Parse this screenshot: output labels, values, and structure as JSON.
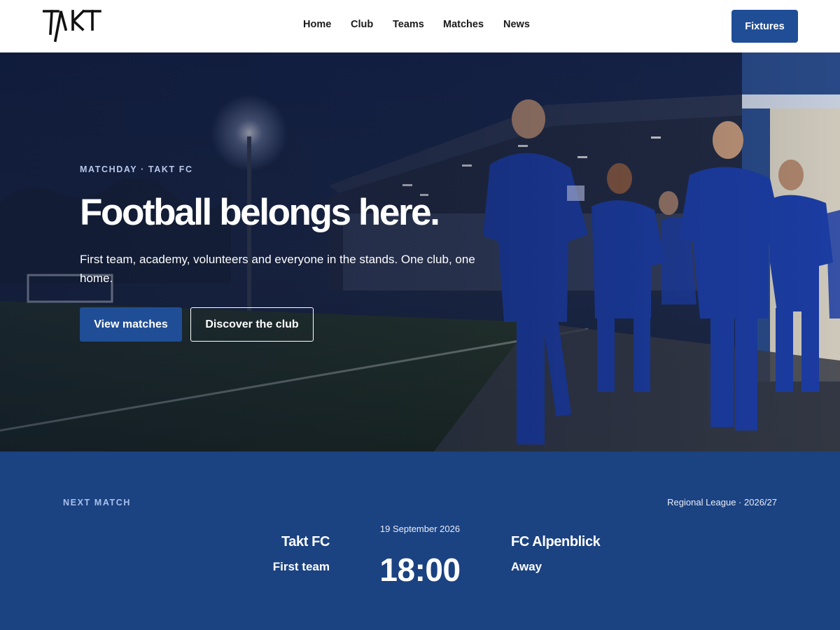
{
  "brand": {
    "logo_text": "TAKT",
    "primary_color": "#1f4e96",
    "band_color": "#1b4281"
  },
  "nav": {
    "items": [
      {
        "label": "Home"
      },
      {
        "label": "Club"
      },
      {
        "label": "Teams"
      },
      {
        "label": "Matches"
      },
      {
        "label": "News"
      }
    ],
    "cta_label": "Fixtures"
  },
  "hero": {
    "eyebrow": "MATCHDAY · TAKT FC",
    "title": "Football belongs here.",
    "subtitle": "First team, academy, volunteers and everyone in the stands. One club, one home.",
    "primary_button": "View matches",
    "secondary_button": "Discover the club"
  },
  "next_match": {
    "label": "NEXT MATCH",
    "competition": "Regional League · 2026/27",
    "date": "19 September 2026",
    "time": "18:00",
    "home": {
      "name": "Takt FC",
      "detail": "First team"
    },
    "away": {
      "name": "FC Alpenblick",
      "detail": "Away"
    }
  }
}
